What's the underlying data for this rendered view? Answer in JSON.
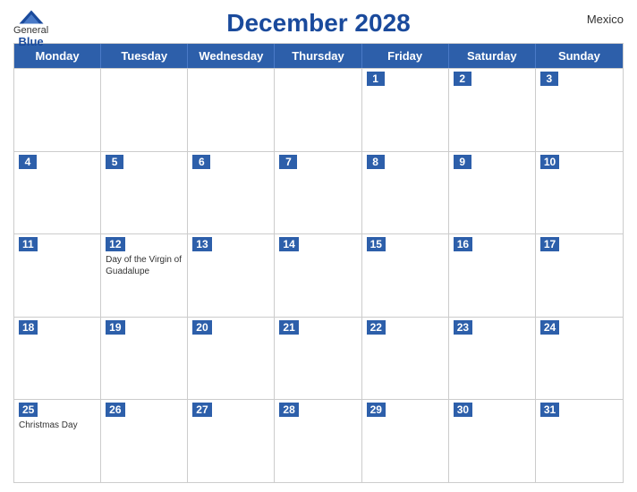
{
  "header": {
    "title": "December 2028",
    "country": "Mexico",
    "logo": {
      "general": "General",
      "blue": "Blue"
    }
  },
  "weekdays": [
    "Monday",
    "Tuesday",
    "Wednesday",
    "Thursday",
    "Friday",
    "Saturday",
    "Sunday"
  ],
  "weeks": [
    [
      {
        "day": "",
        "event": ""
      },
      {
        "day": "",
        "event": ""
      },
      {
        "day": "",
        "event": ""
      },
      {
        "day": "",
        "event": ""
      },
      {
        "day": "1",
        "event": ""
      },
      {
        "day": "2",
        "event": ""
      },
      {
        "day": "3",
        "event": ""
      }
    ],
    [
      {
        "day": "4",
        "event": ""
      },
      {
        "day": "5",
        "event": ""
      },
      {
        "day": "6",
        "event": ""
      },
      {
        "day": "7",
        "event": ""
      },
      {
        "day": "8",
        "event": ""
      },
      {
        "day": "9",
        "event": ""
      },
      {
        "day": "10",
        "event": ""
      }
    ],
    [
      {
        "day": "11",
        "event": ""
      },
      {
        "day": "12",
        "event": "Day of the Virgin of Guadalupe"
      },
      {
        "day": "13",
        "event": ""
      },
      {
        "day": "14",
        "event": ""
      },
      {
        "day": "15",
        "event": ""
      },
      {
        "day": "16",
        "event": ""
      },
      {
        "day": "17",
        "event": ""
      }
    ],
    [
      {
        "day": "18",
        "event": ""
      },
      {
        "day": "19",
        "event": ""
      },
      {
        "day": "20",
        "event": ""
      },
      {
        "day": "21",
        "event": ""
      },
      {
        "day": "22",
        "event": ""
      },
      {
        "day": "23",
        "event": ""
      },
      {
        "day": "24",
        "event": ""
      }
    ],
    [
      {
        "day": "25",
        "event": "Christmas Day"
      },
      {
        "day": "26",
        "event": ""
      },
      {
        "day": "27",
        "event": ""
      },
      {
        "day": "28",
        "event": ""
      },
      {
        "day": "29",
        "event": ""
      },
      {
        "day": "30",
        "event": ""
      },
      {
        "day": "31",
        "event": ""
      }
    ]
  ]
}
